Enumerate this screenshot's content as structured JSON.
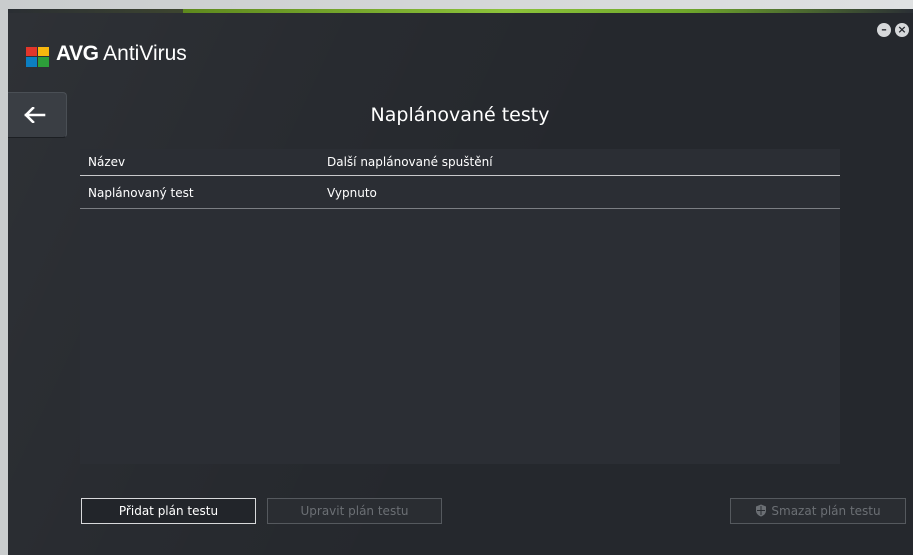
{
  "app": {
    "brand": "AVG",
    "product": "AntiVirus"
  },
  "window_controls": {
    "minimize": "–",
    "close": "×"
  },
  "page": {
    "title": "Naplánované testy"
  },
  "table": {
    "columns": [
      "Název",
      "Další naplánované spuštění"
    ],
    "rows": [
      [
        "Naplánovaný test",
        "Vypnuto"
      ]
    ]
  },
  "buttons": {
    "add": "Přidat plán testu",
    "edit": "Upravit plán testu",
    "delete": "Smazat plán testu",
    "edit_enabled": false,
    "delete_enabled": false
  },
  "icons": {
    "back": "arrow-left-icon",
    "logo": "avg-logo-icon",
    "delete": "shield-icon"
  },
  "colors": {
    "window_bg": "#25282d",
    "table_bg": "#2b2e34",
    "accent_green": "#8cc23a",
    "text": "#ffffff",
    "disabled_text": "#6b6f74"
  }
}
